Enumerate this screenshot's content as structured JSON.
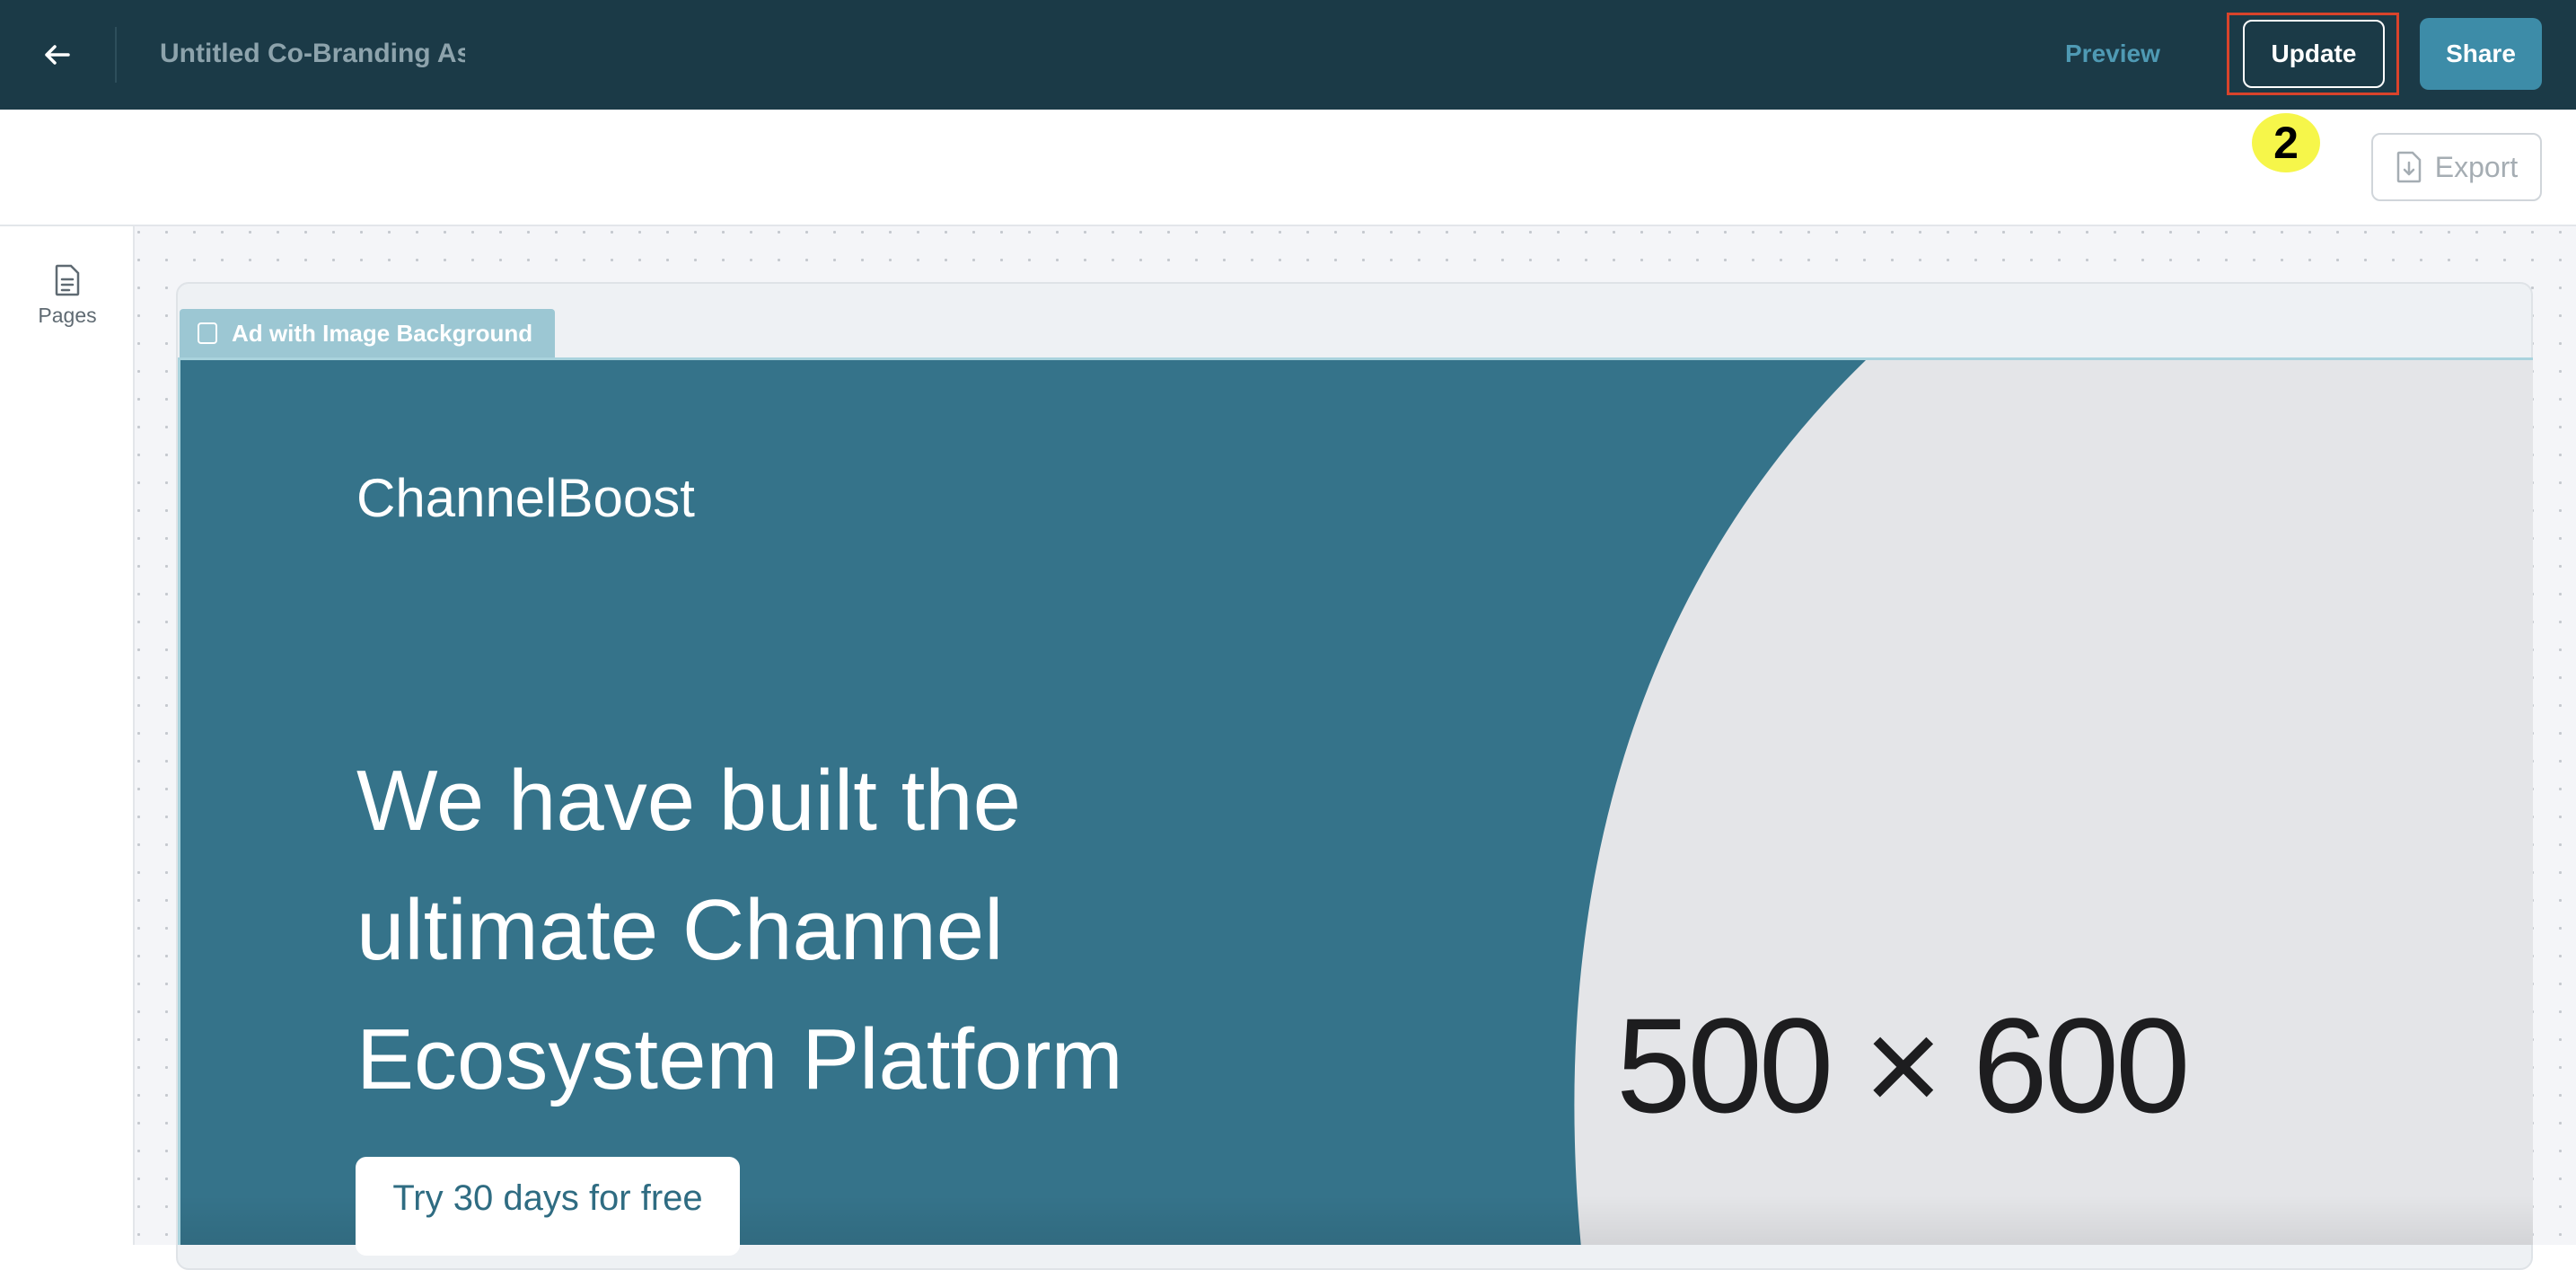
{
  "header": {
    "back_icon": "arrow-left-icon",
    "title": "Untitled Co-Branding As",
    "preview_label": "Preview",
    "update_label": "Update",
    "share_label": "Share"
  },
  "toolbar": {
    "step_badge": "2",
    "export_label": "Export",
    "export_icon": "file-download-icon"
  },
  "sidebar": {
    "items": [
      {
        "label": "Pages",
        "icon": "document-icon"
      }
    ]
  },
  "canvas": {
    "frame_label": "Ad with Image Background",
    "ad": {
      "brand": "ChannelBoost",
      "headline_lines": [
        "We have built the",
        "ultimate Channel",
        "Ecosystem Platform"
      ],
      "cta_label": "Try 30 days for free",
      "image_placeholder": "500 × 600"
    }
  },
  "colors": {
    "topbar": "#1b3a47",
    "accent": "#3d8ca8",
    "ad_background": "#35738a",
    "highlight": "#d9432b",
    "badge": "#f6f64a"
  }
}
